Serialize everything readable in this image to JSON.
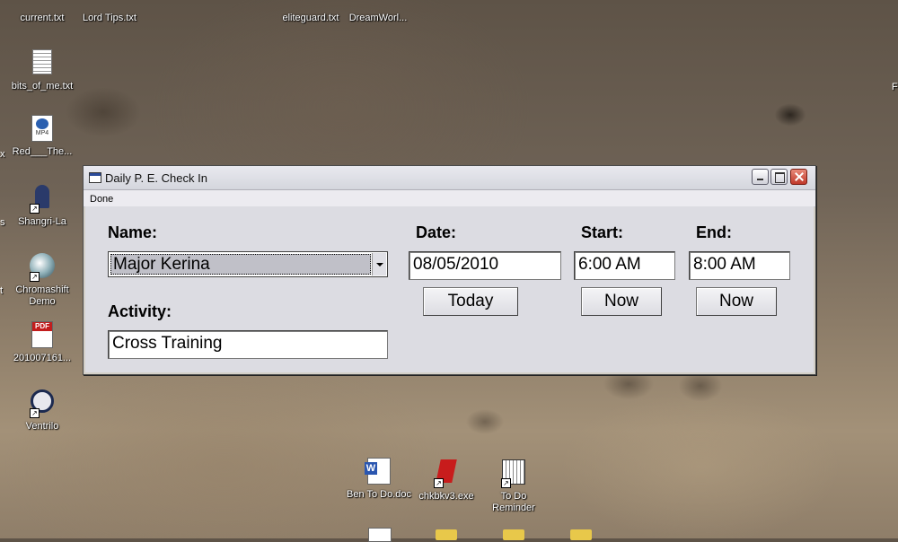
{
  "desktop": {
    "icons": [
      {
        "label": "current.txt"
      },
      {
        "label": "Lord Tips.txt"
      },
      {
        "label": "eliteguard.txt"
      },
      {
        "label": "DreamWorl..."
      },
      {
        "label": "bits_of_me.txt"
      },
      {
        "label": "Red___The..."
      },
      {
        "label": "Shangri-La"
      },
      {
        "label": "Chromashift Demo"
      },
      {
        "label": "201007161..."
      },
      {
        "label": "Ventrilo"
      },
      {
        "label": "Ben To Do.doc"
      },
      {
        "label": "chkbkv3.exe"
      },
      {
        "label": "To Do Reminder"
      }
    ],
    "edge_fragments": {
      "left_x": "x",
      "left_s": "s",
      "left_t": "t",
      "right_f": "F"
    },
    "icon_badges": {
      "mp4": "MP4",
      "pdf": "PDF"
    }
  },
  "window": {
    "title": "Daily P. E. Check In",
    "menu": [
      "Done"
    ],
    "name_label": "Name:",
    "name_value": "Major Kerina",
    "activity_label": "Activity:",
    "activity_value": "Cross Training",
    "date_label": "Date:",
    "date_value": "08/05/2010",
    "today_button": "Today",
    "start_label": "Start:",
    "start_value": "6:00 AM",
    "start_now_button": "Now",
    "end_label": "End:",
    "end_value": "8:00 AM",
    "end_now_button": "Now"
  }
}
